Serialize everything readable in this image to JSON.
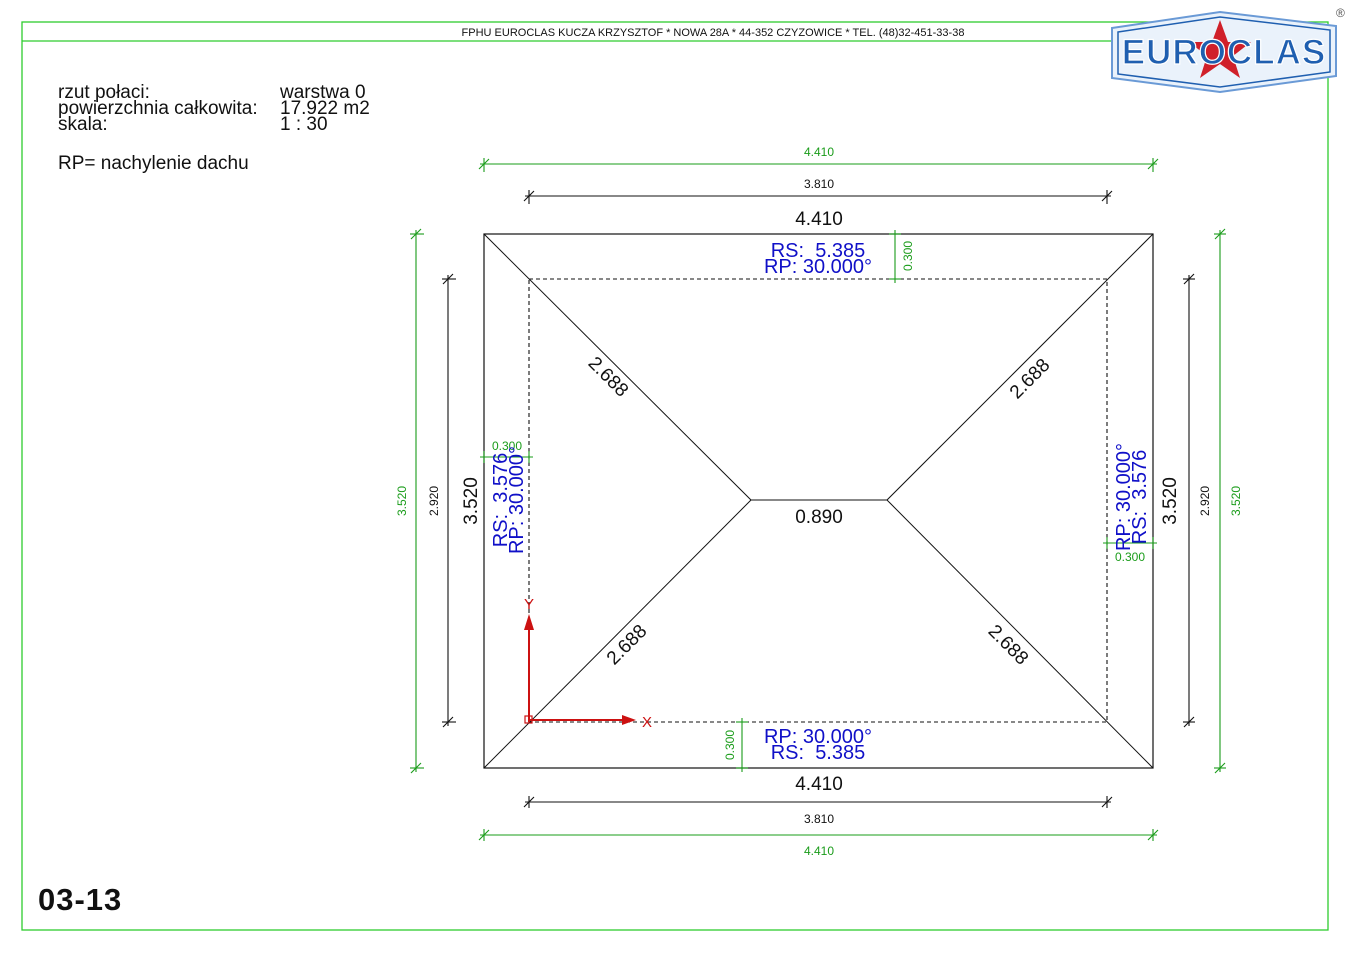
{
  "header": {
    "company_line": "FPHU EUROCLAS KUCZA KRZYSZTOF * NOWA 28A * 44-352 CZYZOWICE * TEL. (48)32-451-33-38",
    "logo_text": "EUROCLAS",
    "registered_mark": "®"
  },
  "info": {
    "label_layer": "rzut połaci:",
    "value_layer": "warstwa 0",
    "label_area": "powierzchnia całkowita:",
    "value_area": "17.922 m2",
    "label_scale": "skala:",
    "value_scale": "1 : 30",
    "legend": "RP= nachylenie dachu"
  },
  "dimensions": {
    "outer_width": "4.410",
    "inner_width": "3.810",
    "outer_height": "3.520",
    "inner_height": "2.920",
    "overhang": "0.300",
    "ridge": "0.890",
    "hip": "2.688"
  },
  "faces": {
    "top": {
      "rs": "RS:  5.385",
      "rp": "RP: 30.000°"
    },
    "bottom": {
      "rp": "RP: 30.000°",
      "rs": "RS:  5.385"
    },
    "left": {
      "rs": "RS:  3.576",
      "rp": "RP: 30.000°"
    },
    "right": {
      "rp": "RP: 30.000°",
      "rs": "RS:  3.576"
    }
  },
  "axes": {
    "x_label": "X",
    "y_label": "Y"
  },
  "sheet_number": "03-13",
  "colors": {
    "frame": "#2ecc2e",
    "dim_green": "#1a9c1a",
    "dim_black": "#111111",
    "face_text": "#1010c8",
    "axis": "#cc1111",
    "logo_blue": "#1f5fb0",
    "logo_red": "#d0202a"
  }
}
